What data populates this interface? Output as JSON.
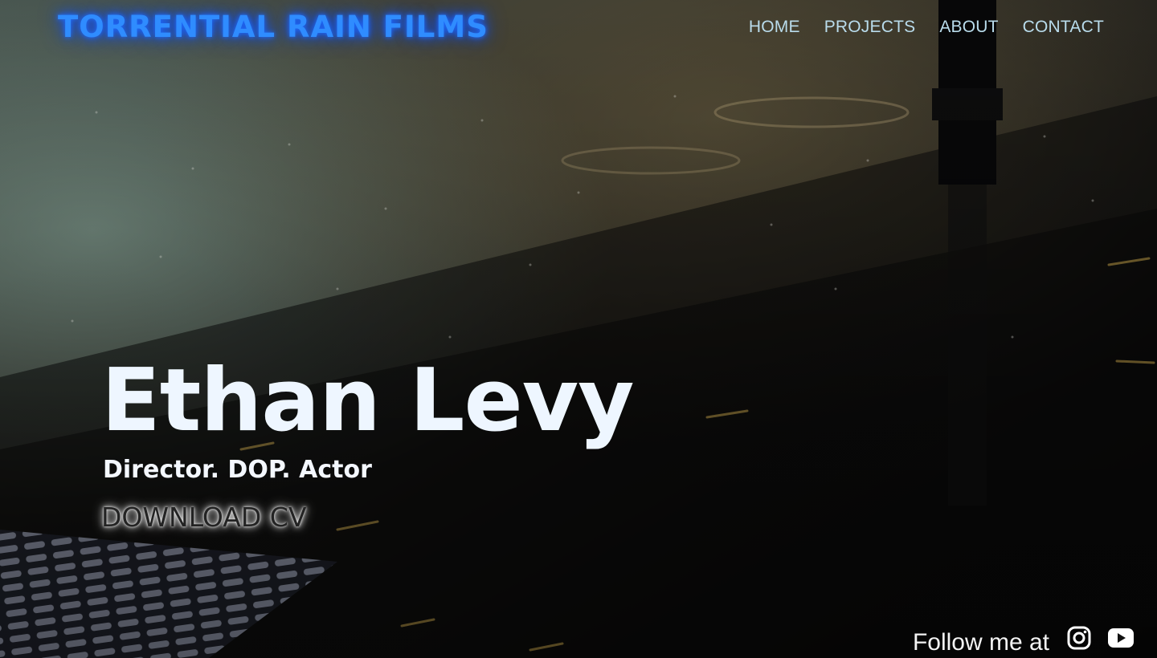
{
  "header": {
    "brand": "TORRENTIAL RAIN FILMS",
    "nav": [
      {
        "label": "HOME"
      },
      {
        "label": "PROJECTS"
      },
      {
        "label": "ABOUT"
      },
      {
        "label": "CONTACT"
      }
    ]
  },
  "hero": {
    "name": "Ethan Levy",
    "roles": "Director. DOP. Actor",
    "cv_label": "DOWNLOAD CV",
    "background": "rain-street-night-image"
  },
  "footer": {
    "follow_label": "Follow me at",
    "social": [
      {
        "icon": "instagram-icon"
      },
      {
        "icon": "youtube-icon"
      }
    ]
  },
  "colors": {
    "brand": "#2f8cff",
    "nav": "#b9dcec",
    "hero_text": "#eef6ff"
  }
}
